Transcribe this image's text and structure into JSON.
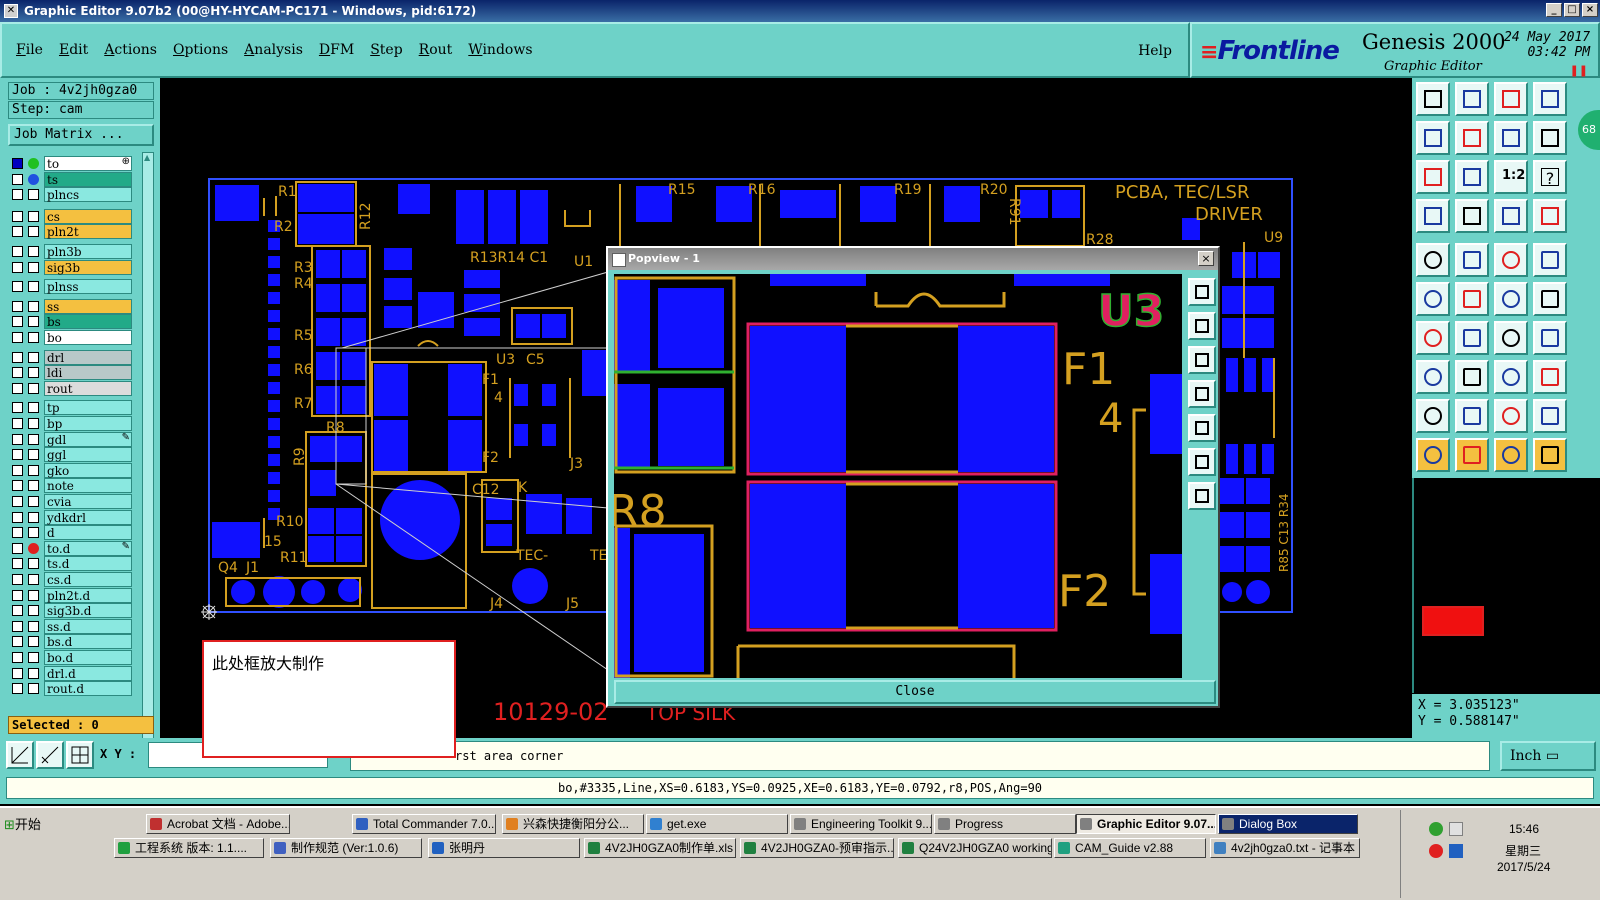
{
  "window": {
    "title": "Graphic Editor 9.07b2 (00@HY-HYCAM-PC171 - Windows, pid:6172)",
    "controls": [
      "_",
      "□",
      "×"
    ]
  },
  "menu": {
    "items": [
      "File",
      "Edit",
      "Actions",
      "Options",
      "Analysis",
      "DFM",
      "Step",
      "Rout",
      "Windows"
    ],
    "help": "Help"
  },
  "brand": {
    "logo": "Frontline",
    "product": "Genesis 2000",
    "subtitle": "Graphic Editor",
    "date": "24 May 2017",
    "time": "03:42 PM"
  },
  "job": {
    "job_label": "Job : 4v2jh0gza0",
    "step_label": "Step: cam",
    "matrix_button": "Job Matrix ..."
  },
  "layers": [
    {
      "name": "to",
      "color": "#ffffff",
      "dot": "#20c020",
      "checked": true,
      "mark": "⊕"
    },
    {
      "name": "ts",
      "color": "#22aa88",
      "dot": "#2050e0",
      "checked": false,
      "mark": ""
    },
    {
      "name": "plncs",
      "color": "#8ae8e0",
      "dot": "",
      "checked": false,
      "mark": ""
    },
    {
      "name": "cs",
      "color": "#f4c040",
      "dot": "",
      "checked": false,
      "mark": ""
    },
    {
      "name": "pln2t",
      "color": "#f4c040",
      "dot": "",
      "checked": false,
      "mark": ""
    },
    {
      "name": "pln3b",
      "color": "#8ae8e0",
      "dot": "",
      "checked": false,
      "mark": ""
    },
    {
      "name": "sig3b",
      "color": "#f4c040",
      "dot": "",
      "checked": false,
      "mark": ""
    },
    {
      "name": "plnss",
      "color": "#8ae8e0",
      "dot": "",
      "checked": false,
      "mark": ""
    },
    {
      "name": "ss",
      "color": "#f4c040",
      "dot": "",
      "checked": false,
      "mark": ""
    },
    {
      "name": "bs",
      "color": "#22aa88",
      "dot": "",
      "checked": false,
      "mark": ""
    },
    {
      "name": "bo",
      "color": "#ffffff",
      "dot": "",
      "checked": false,
      "mark": ""
    },
    {
      "name": "drl",
      "color": "#b8c8c8",
      "dot": "",
      "checked": false,
      "mark": ""
    },
    {
      "name": "ldi",
      "color": "#b8c8c8",
      "dot": "",
      "checked": false,
      "mark": ""
    },
    {
      "name": "rout",
      "color": "#dcdcdc",
      "dot": "",
      "checked": false,
      "mark": ""
    },
    {
      "name": "tp",
      "color": "#8ae8e0",
      "dot": "",
      "checked": false,
      "mark": ""
    },
    {
      "name": "bp",
      "color": "#8ae8e0",
      "dot": "",
      "checked": false,
      "mark": ""
    },
    {
      "name": "gdl",
      "color": "#8ae8e0",
      "dot": "",
      "checked": false,
      "mark": "✎"
    },
    {
      "name": "ggl",
      "color": "#8ae8e0",
      "dot": "",
      "checked": false,
      "mark": ""
    },
    {
      "name": "gko",
      "color": "#8ae8e0",
      "dot": "",
      "checked": false,
      "mark": ""
    },
    {
      "name": "note",
      "color": "#8ae8e0",
      "dot": "",
      "checked": false,
      "mark": ""
    },
    {
      "name": "cvia",
      "color": "#8ae8e0",
      "dot": "",
      "checked": false,
      "mark": ""
    },
    {
      "name": "ydkdrl",
      "color": "#8ae8e0",
      "dot": "",
      "checked": false,
      "mark": ""
    },
    {
      "name": "d",
      "color": "#8ae8e0",
      "dot": "",
      "checked": false,
      "mark": ""
    },
    {
      "name": "to.d",
      "color": "#8ae8e0",
      "dot": "#e02020",
      "checked": false,
      "mark": "✎"
    },
    {
      "name": "ts.d",
      "color": "#8ae8e0",
      "dot": "",
      "checked": false,
      "mark": ""
    },
    {
      "name": "cs.d",
      "color": "#8ae8e0",
      "dot": "",
      "checked": false,
      "mark": ""
    },
    {
      "name": "pln2t.d",
      "color": "#8ae8e0",
      "dot": "",
      "checked": false,
      "mark": ""
    },
    {
      "name": "sig3b.d",
      "color": "#8ae8e0",
      "dot": "",
      "checked": false,
      "mark": ""
    },
    {
      "name": "ss.d",
      "color": "#8ae8e0",
      "dot": "",
      "checked": false,
      "mark": ""
    },
    {
      "name": "bs.d",
      "color": "#8ae8e0",
      "dot": "",
      "checked": false,
      "mark": ""
    },
    {
      "name": "bo.d",
      "color": "#8ae8e0",
      "dot": "",
      "checked": false,
      "mark": ""
    },
    {
      "name": "drl.d",
      "color": "#8ae8e0",
      "dot": "",
      "checked": false,
      "mark": ""
    },
    {
      "name": "rout.d",
      "color": "#8ae8e0",
      "dot": "",
      "checked": false,
      "mark": ""
    }
  ],
  "selected": "Selected : 0",
  "pcb_labels": {
    "r1": "R1",
    "r2": "R2",
    "r12": "R12",
    "r15": "R15",
    "r16": "R16",
    "r19": "R19",
    "r20": "R20",
    "r91": "R91",
    "title": "PCBA, TEC/LSR",
    "driver": "DRIVER",
    "r28": "R28",
    "u9": "U9",
    "r13r14c1": "R13R14 C1",
    "u1": "U1",
    "r3": "R3",
    "r4": "R4",
    "r5": "R5",
    "r6": "R6",
    "r7": "R7",
    "r8": "R8",
    "r9": "R9",
    "r10": "R10",
    "n15": "15",
    "r11": "R11",
    "q4": "Q4",
    "j1": "J1",
    "u3": "U3",
    "c5": "C5",
    "f1": "F1",
    "n4": "4",
    "f2": "F2",
    "j3": "J3",
    "c12": "C12",
    "k": "K",
    "tec": "TEC-",
    "te": "TE",
    "j4": "J4",
    "j5": "J5",
    "side": "R85 C13 R34",
    "part_number": "10129-02",
    "silk": "TOP SILK"
  },
  "popview": {
    "title": "Popview - 1",
    "close_x": "×",
    "close_button": "Close",
    "labels": {
      "u3": "U3",
      "f1": "F1",
      "n4": "4",
      "f2": "F2",
      "r8": "R8"
    }
  },
  "note": "此处框放大制作",
  "coords": {
    "x": "X = 3.035123\"",
    "y": "Y = 0.588147\""
  },
  "bottom": {
    "xy_label": "X Y :",
    "prompt": "rst area corner",
    "units": "Inch ▭"
  },
  "status": "bo,#3335,Line,XS=0.6183,YS=0.0925,XE=0.6183,YE=0.0792,r8,POS,Ang=90",
  "right_tools": {
    "ratio_label": "1:2",
    "help_label": "?",
    "badge": "68"
  },
  "taskbar": {
    "start": "开始",
    "row1": [
      {
        "label": "Acrobat 文档 - Adobe...",
        "icon": "#c03030"
      },
      {
        "label": "Total Commander 7.0...",
        "icon": "#3060c0"
      },
      {
        "label": "兴森快捷衡阳分公...",
        "icon": "#e08020"
      },
      {
        "label": "get.exe",
        "icon": "#3080d0"
      },
      {
        "label": "Engineering Toolkit 9....",
        "icon": "#808080"
      },
      {
        "label": "Progress",
        "icon": "#808080"
      },
      {
        "label": "Graphic Editor 9.07...",
        "icon": "#808080"
      },
      {
        "label": "Dialog Box",
        "icon": "#808080"
      }
    ],
    "row2": [
      {
        "label": "工程系统  版本: 1.1....",
        "icon": "#20a040"
      },
      {
        "label": "制作规范 (Ver:1.0.6)",
        "icon": "#4060c0"
      },
      {
        "label": "张明丹",
        "icon": "#2060c0"
      },
      {
        "label": "4V2JH0GZA0制作单.xls ...",
        "icon": "#208040"
      },
      {
        "label": "4V2JH0GZA0-预审指示...",
        "icon": "#208040"
      },
      {
        "label": "Q24V2JH0GZA0 working...",
        "icon": "#208040"
      },
      {
        "label": "CAM_Guide v2.88",
        "icon": "#20a080"
      },
      {
        "label": "4v2jh0gza0.txt - 记事本",
        "icon": "#4080c0"
      }
    ],
    "time": "15:46",
    "weekday": "星期三",
    "date": "2017/5/24"
  }
}
